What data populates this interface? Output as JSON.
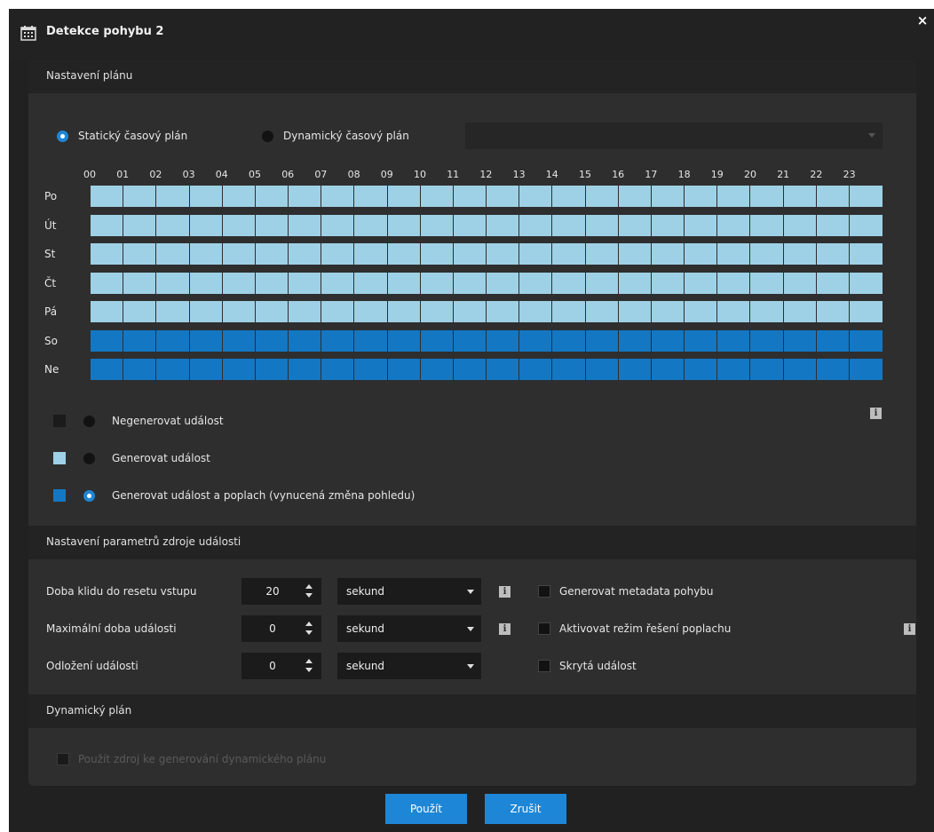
{
  "window": {
    "title": "Detekce pohybu 2",
    "icon": "calendar-icon",
    "close_label": "×"
  },
  "schedule_section": {
    "title": "Nastavení plánu",
    "static_label": "Statický časový plán",
    "dynamic_label": "Dynamický časový plán",
    "static_selected": true,
    "dynamic_value": ""
  },
  "hours": [
    "00",
    "01",
    "02",
    "03",
    "04",
    "05",
    "06",
    "07",
    "08",
    "09",
    "10",
    "11",
    "12",
    "13",
    "14",
    "15",
    "16",
    "17",
    "18",
    "19",
    "20",
    "21",
    "22",
    "23"
  ],
  "days": [
    {
      "label": "Po",
      "mode": "event"
    },
    {
      "label": "Út",
      "mode": "event"
    },
    {
      "label": "St",
      "mode": "event"
    },
    {
      "label": "Čt",
      "mode": "event"
    },
    {
      "label": "Pá",
      "mode": "event"
    },
    {
      "label": "So",
      "mode": "alarm"
    },
    {
      "label": "Ne",
      "mode": "alarm"
    }
  ],
  "colors": {
    "none": "#1b1b1b",
    "event": "#9fd1e6",
    "alarm": "#1477c3",
    "accent": "#1e86d6"
  },
  "legend": {
    "none_label": "Negenerovat událost",
    "event_label": "Generovat událost",
    "alarm_label": "Generovat událost a poplach (vynucená změna pohledu)",
    "selected": "alarm"
  },
  "params_section": {
    "title": "Nastavení parametrů zdroje události",
    "rows": [
      {
        "label": "Doba klidu do resetu vstupu",
        "value": "20",
        "unit": "sekund"
      },
      {
        "label": "Maximální doba události",
        "value": "0",
        "unit": "sekund"
      },
      {
        "label": "Odložení události",
        "value": "0",
        "unit": "sekund"
      }
    ],
    "checks": [
      {
        "label": "Generovat metadata pohybu",
        "checked": false
      },
      {
        "label": "Aktivovat režim řešení poplachu",
        "checked": false
      },
      {
        "label": "Skrytá událost",
        "checked": false
      }
    ]
  },
  "dynamic_section": {
    "title": "Dynamický plán",
    "check_label": "Použít zdroj ke generování dynamického plánu",
    "disabled": true
  },
  "buttons": {
    "apply": "Použít",
    "cancel": "Zrušit"
  }
}
